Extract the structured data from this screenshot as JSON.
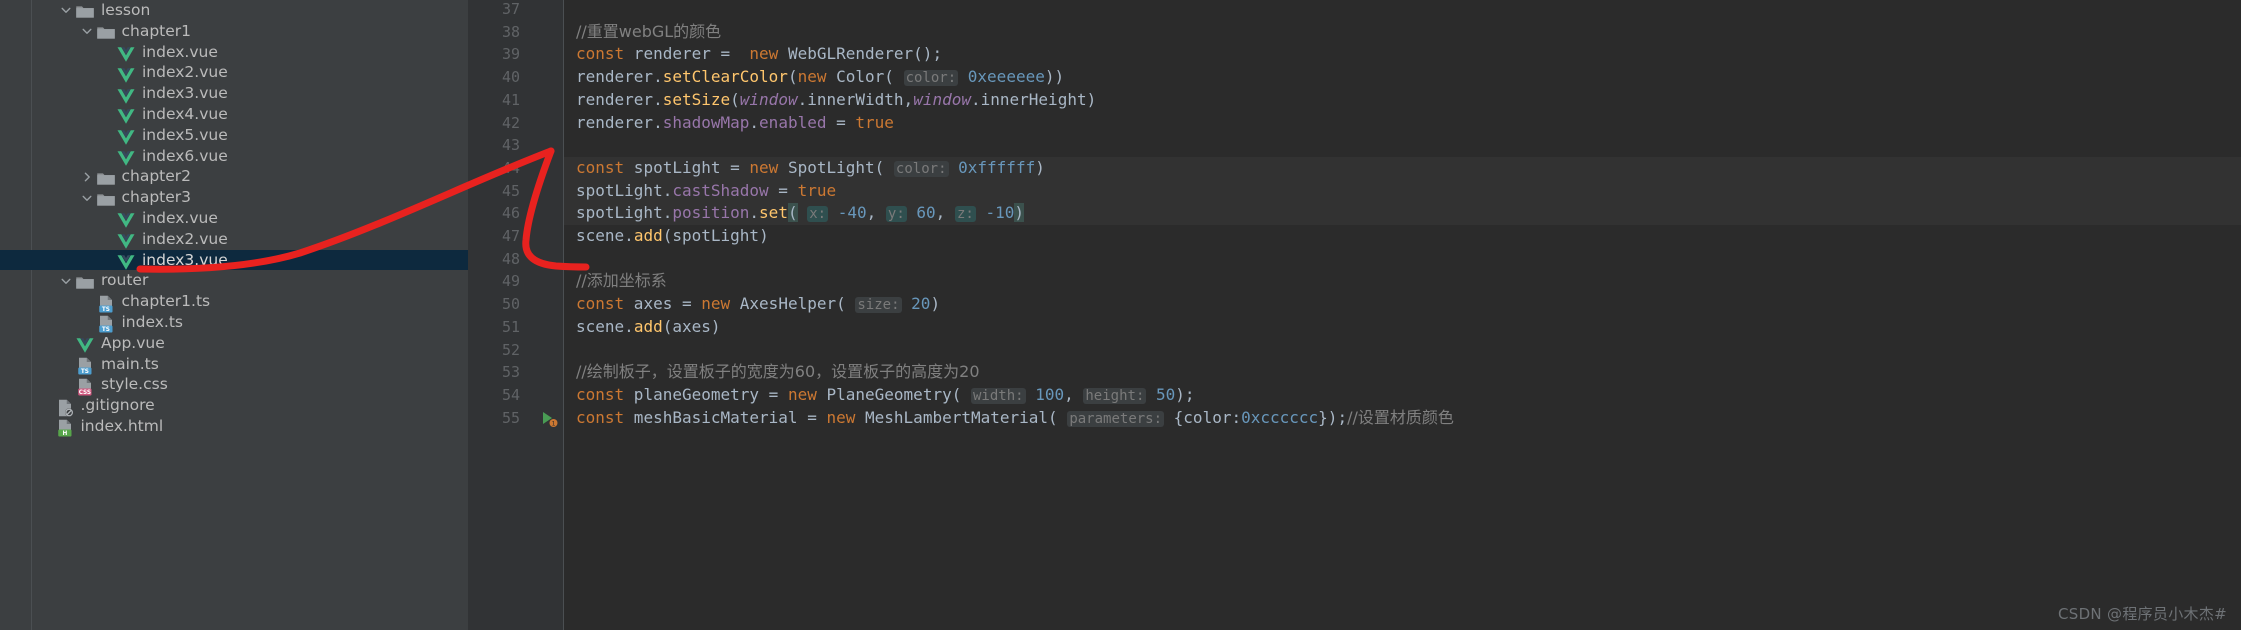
{
  "sidebar": {
    "name": "project-file-tree",
    "items": [
      {
        "label": "lesson",
        "type": "folder",
        "depth": 2,
        "arrow": "down",
        "selected": false
      },
      {
        "label": "chapter1",
        "type": "folder",
        "depth": 3,
        "arrow": "down",
        "selected": false
      },
      {
        "label": "index.vue",
        "type": "vue",
        "depth": 4,
        "arrow": "none",
        "selected": false
      },
      {
        "label": "index2.vue",
        "type": "vue",
        "depth": 4,
        "arrow": "none",
        "selected": false
      },
      {
        "label": "index3.vue",
        "type": "vue",
        "depth": 4,
        "arrow": "none",
        "selected": false
      },
      {
        "label": "index4.vue",
        "type": "vue",
        "depth": 4,
        "arrow": "none",
        "selected": false
      },
      {
        "label": "index5.vue",
        "type": "vue",
        "depth": 4,
        "arrow": "none",
        "selected": false
      },
      {
        "label": "index6.vue",
        "type": "vue",
        "depth": 4,
        "arrow": "none",
        "selected": false
      },
      {
        "label": "chapter2",
        "type": "folder",
        "depth": 3,
        "arrow": "right",
        "selected": false
      },
      {
        "label": "chapter3",
        "type": "folder",
        "depth": 3,
        "arrow": "down",
        "selected": false
      },
      {
        "label": "index.vue",
        "type": "vue",
        "depth": 4,
        "arrow": "none",
        "selected": false
      },
      {
        "label": "index2.vue",
        "type": "vue",
        "depth": 4,
        "arrow": "none",
        "selected": false
      },
      {
        "label": "index3.vue",
        "type": "vue",
        "depth": 4,
        "arrow": "none",
        "selected": true
      },
      {
        "label": "router",
        "type": "folder",
        "depth": 2,
        "arrow": "down",
        "selected": false
      },
      {
        "label": "chapter1.ts",
        "type": "ts",
        "depth": 3,
        "arrow": "none",
        "selected": false
      },
      {
        "label": "index.ts",
        "type": "ts",
        "depth": 3,
        "arrow": "none",
        "selected": false
      },
      {
        "label": "App.vue",
        "type": "vue",
        "depth": 2,
        "arrow": "none",
        "selected": false
      },
      {
        "label": "main.ts",
        "type": "ts",
        "depth": 2,
        "arrow": "none",
        "selected": false
      },
      {
        "label": "style.css",
        "type": "css",
        "depth": 2,
        "arrow": "none",
        "selected": false
      },
      {
        "label": ".gitignore",
        "type": "git",
        "depth": 1,
        "arrow": "none",
        "selected": false
      },
      {
        "label": "index.html",
        "type": "html",
        "depth": 1,
        "arrow": "none",
        "selected": false
      }
    ]
  },
  "editor": {
    "name": "code-editor",
    "first_line": 37,
    "line_numbers": [
      37,
      38,
      39,
      40,
      41,
      42,
      43,
      44,
      45,
      46,
      47,
      48,
      49,
      50,
      51,
      52,
      53,
      54,
      55
    ],
    "highlighted_lines": [
      44,
      45,
      46
    ],
    "gutter_run_marker_line": 55,
    "lines": [
      {
        "n": 37,
        "tokens": []
      },
      {
        "n": 38,
        "tokens": [
          {
            "t": "//重置webGL的颜色",
            "c": "cmt"
          }
        ]
      },
      {
        "n": 39,
        "tokens": [
          {
            "t": "const",
            "c": "kw"
          },
          {
            "t": " renderer = ",
            "c": "id"
          },
          {
            "t": " new",
            "c": "kw"
          },
          {
            "t": " ",
            "c": "id"
          },
          {
            "t": "WebGLRenderer",
            "c": "cls"
          },
          {
            "t": "();",
            "c": "punc"
          }
        ]
      },
      {
        "n": 40,
        "tokens": [
          {
            "t": "renderer",
            "c": "id"
          },
          {
            "t": ".",
            "c": "punc"
          },
          {
            "t": "setClearColor",
            "c": "fn"
          },
          {
            "t": "(",
            "c": "punc"
          },
          {
            "t": "new",
            "c": "kw"
          },
          {
            "t": " ",
            "c": "id"
          },
          {
            "t": "Color",
            "c": "cls"
          },
          {
            "t": "( ",
            "c": "punc"
          },
          {
            "t": "color:",
            "c": "hintbox"
          },
          {
            "t": " ",
            "c": "id"
          },
          {
            "t": "0xeeeeee",
            "c": "num"
          },
          {
            "t": "))",
            "c": "punc"
          }
        ]
      },
      {
        "n": 41,
        "tokens": [
          {
            "t": "renderer",
            "c": "id"
          },
          {
            "t": ".",
            "c": "punc"
          },
          {
            "t": "setSize",
            "c": "fn"
          },
          {
            "t": "(",
            "c": "punc"
          },
          {
            "t": "window",
            "c": "glob"
          },
          {
            "t": ".",
            "c": "punc"
          },
          {
            "t": "innerWidth",
            "c": "id"
          },
          {
            "t": ",",
            "c": "punc"
          },
          {
            "t": "window",
            "c": "glob"
          },
          {
            "t": ".",
            "c": "punc"
          },
          {
            "t": "innerHeight",
            "c": "id"
          },
          {
            "t": ")",
            "c": "punc"
          }
        ]
      },
      {
        "n": 42,
        "tokens": [
          {
            "t": "renderer",
            "c": "id"
          },
          {
            "t": ".",
            "c": "punc"
          },
          {
            "t": "shadowMap",
            "c": "prop"
          },
          {
            "t": ".",
            "c": "punc"
          },
          {
            "t": "enabled",
            "c": "prop"
          },
          {
            "t": " = ",
            "c": "punc"
          },
          {
            "t": "true",
            "c": "kw"
          }
        ]
      },
      {
        "n": 43,
        "tokens": []
      },
      {
        "n": 44,
        "tokens": [
          {
            "t": "const",
            "c": "kw"
          },
          {
            "t": " spotLight = ",
            "c": "id"
          },
          {
            "t": "new",
            "c": "kw"
          },
          {
            "t": " ",
            "c": "id"
          },
          {
            "t": "SpotLight",
            "c": "cls"
          },
          {
            "t": "( ",
            "c": "punc"
          },
          {
            "t": "color:",
            "c": "hintbox"
          },
          {
            "t": " ",
            "c": "id"
          },
          {
            "t": "0xffffff",
            "c": "num"
          },
          {
            "t": ")",
            "c": "punc"
          }
        ]
      },
      {
        "n": 45,
        "tokens": [
          {
            "t": "spotLight",
            "c": "id"
          },
          {
            "t": ".",
            "c": "punc"
          },
          {
            "t": "castShadow",
            "c": "prop"
          },
          {
            "t": " = ",
            "c": "punc"
          },
          {
            "t": "true",
            "c": "kw"
          }
        ]
      },
      {
        "n": 46,
        "tokens": [
          {
            "t": "spotLight",
            "c": "id"
          },
          {
            "t": ".",
            "c": "punc"
          },
          {
            "t": "position",
            "c": "prop"
          },
          {
            "t": ".",
            "c": "punc"
          },
          {
            "t": "set",
            "c": "fn"
          },
          {
            "t": "(",
            "c": "brk"
          },
          {
            "t": " ",
            "c": "id"
          },
          {
            "t": "x:",
            "c": "hintbox sel"
          },
          {
            "t": " ",
            "c": "id"
          },
          {
            "t": "-40",
            "c": "num"
          },
          {
            "t": ", ",
            "c": "punc"
          },
          {
            "t": "y:",
            "c": "hintbox sel"
          },
          {
            "t": " ",
            "c": "id"
          },
          {
            "t": "60",
            "c": "num"
          },
          {
            "t": ", ",
            "c": "punc"
          },
          {
            "t": "z:",
            "c": "hintbox sel"
          },
          {
            "t": " ",
            "c": "id"
          },
          {
            "t": "-10",
            "c": "num"
          },
          {
            "t": ")",
            "c": "brk"
          }
        ]
      },
      {
        "n": 47,
        "tokens": [
          {
            "t": "scene",
            "c": "id"
          },
          {
            "t": ".",
            "c": "punc"
          },
          {
            "t": "add",
            "c": "fn"
          },
          {
            "t": "(",
            "c": "punc"
          },
          {
            "t": "spotLight",
            "c": "id"
          },
          {
            "t": ")",
            "c": "punc"
          }
        ]
      },
      {
        "n": 48,
        "tokens": []
      },
      {
        "n": 49,
        "tokens": [
          {
            "t": "//添加坐标系",
            "c": "cmt"
          }
        ]
      },
      {
        "n": 50,
        "tokens": [
          {
            "t": "const",
            "c": "kw"
          },
          {
            "t": " axes = ",
            "c": "id"
          },
          {
            "t": "new",
            "c": "kw"
          },
          {
            "t": " ",
            "c": "id"
          },
          {
            "t": "AxesHelper",
            "c": "cls"
          },
          {
            "t": "( ",
            "c": "punc"
          },
          {
            "t": "size:",
            "c": "hintbox"
          },
          {
            "t": " ",
            "c": "id"
          },
          {
            "t": "20",
            "c": "num"
          },
          {
            "t": ")",
            "c": "punc"
          }
        ]
      },
      {
        "n": 51,
        "tokens": [
          {
            "t": "scene",
            "c": "id"
          },
          {
            "t": ".",
            "c": "punc"
          },
          {
            "t": "add",
            "c": "fn"
          },
          {
            "t": "(",
            "c": "punc"
          },
          {
            "t": "axes",
            "c": "id"
          },
          {
            "t": ")",
            "c": "punc"
          }
        ]
      },
      {
        "n": 52,
        "tokens": []
      },
      {
        "n": 53,
        "tokens": [
          {
            "t": "//绘制板子，设置板子的宽度为60，设置板子的高度为20",
            "c": "cmt"
          }
        ]
      },
      {
        "n": 54,
        "tokens": [
          {
            "t": "const",
            "c": "kw"
          },
          {
            "t": " planeGeometry = ",
            "c": "id"
          },
          {
            "t": "new",
            "c": "kw"
          },
          {
            "t": " ",
            "c": "id"
          },
          {
            "t": "PlaneGeometry",
            "c": "cls"
          },
          {
            "t": "( ",
            "c": "punc"
          },
          {
            "t": "width:",
            "c": "hintbox"
          },
          {
            "t": " ",
            "c": "id"
          },
          {
            "t": "100",
            "c": "num"
          },
          {
            "t": ", ",
            "c": "punc"
          },
          {
            "t": "height:",
            "c": "hintbox"
          },
          {
            "t": " ",
            "c": "id"
          },
          {
            "t": "50",
            "c": "num"
          },
          {
            "t": ");",
            "c": "punc"
          }
        ]
      },
      {
        "n": 55,
        "tokens": [
          {
            "t": "const",
            "c": "kw"
          },
          {
            "t": " meshBasicMaterial = ",
            "c": "id"
          },
          {
            "t": "new",
            "c": "kw"
          },
          {
            "t": " ",
            "c": "id"
          },
          {
            "t": "MeshLambertMaterial",
            "c": "cls"
          },
          {
            "t": "( ",
            "c": "punc"
          },
          {
            "t": "parameters:",
            "c": "hintbox"
          },
          {
            "t": " {",
            "c": "punc"
          },
          {
            "t": "color",
            "c": "id"
          },
          {
            "t": ":",
            "c": "punc"
          },
          {
            "t": "0xcccccc",
            "c": "num"
          },
          {
            "t": "});",
            "c": "punc"
          },
          {
            "t": "//设置材质颜色",
            "c": "cmt"
          }
        ]
      }
    ]
  },
  "annotation": {
    "name": "red-ink-arrow",
    "color": "#e8221f",
    "description": "hand-drawn red arrow pointing from code block to index3.vue"
  },
  "watermark": {
    "text": "CSDN @程序员小木杰#"
  },
  "colors": {
    "sidebar_bg": "#3c3f41",
    "editor_bg": "#2b2b2b",
    "gutter_bg": "#313335",
    "selection_bg": "#0d293e",
    "line_highlight": "#323232",
    "keyword": "#cc7832",
    "function": "#ffc66d",
    "property": "#9876aa",
    "number": "#6897bb",
    "comment": "#808080",
    "text": "#a9b7c6",
    "vue_green": "#41b883",
    "ts_blue": "#4d9ecf",
    "css_pink": "#d0577f"
  }
}
